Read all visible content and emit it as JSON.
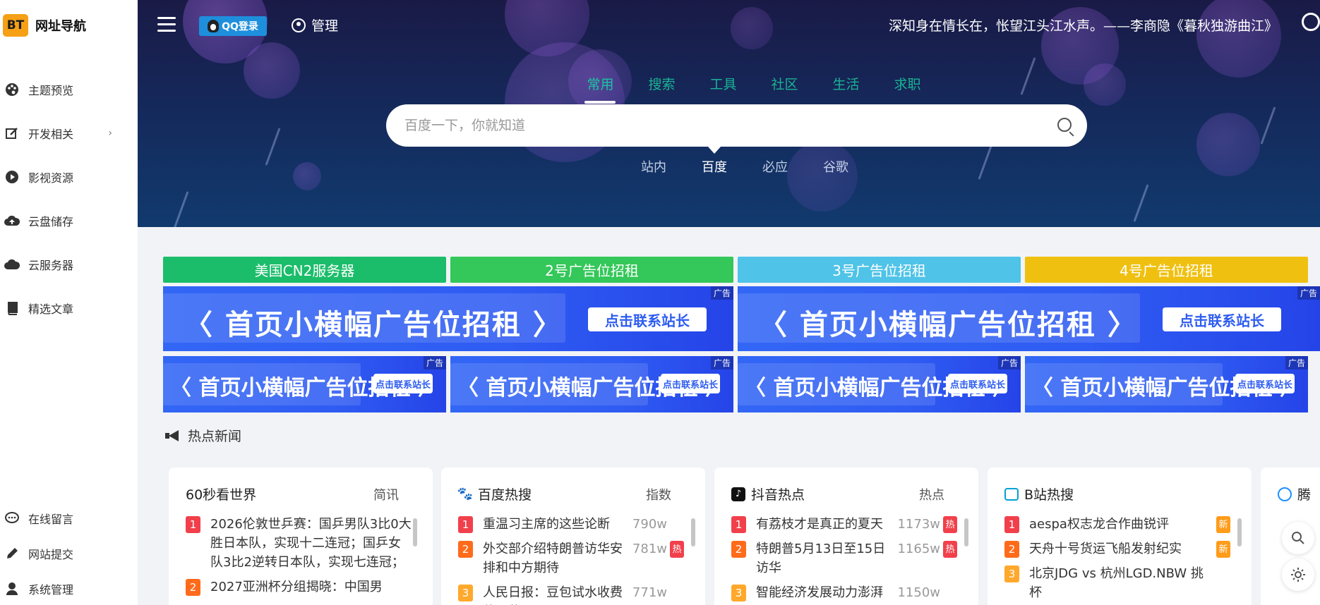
{
  "sidebar": {
    "logo_badge": "BT",
    "logo_text": "网址导航",
    "items": [
      {
        "label": "主题预览"
      },
      {
        "label": "开发相关"
      },
      {
        "label": "影视资源"
      },
      {
        "label": "云盘储存"
      },
      {
        "label": "云服务器"
      },
      {
        "label": "精选文章"
      }
    ],
    "bottom_items": [
      {
        "label": "在线留言"
      },
      {
        "label": "网站提交"
      },
      {
        "label": "系统管理"
      }
    ]
  },
  "header": {
    "qq_login": "QQ登录",
    "admin": "管理",
    "quote": "深知身在情长在，怅望江头江水声。——李商隐《暮秋独游曲江》"
  },
  "search": {
    "tabs": [
      "常用",
      "搜索",
      "工具",
      "社区",
      "生活",
      "求职"
    ],
    "active_tab": "常用",
    "placeholder": "百度一下，你就知道",
    "engines": [
      "站内",
      "百度",
      "必应",
      "谷歌"
    ],
    "active_engine": "百度"
  },
  "ads": {
    "labels": [
      {
        "text": "美国CN2服务器",
        "color": "#1bbd6a"
      },
      {
        "text": "2号广告位招租",
        "color": "#34c759"
      },
      {
        "text": "3号广告位招租",
        "color": "#4fc3e8"
      },
      {
        "text": "4号广告位招租",
        "color": "#f0c010"
      }
    ],
    "banner_text": "〈 首页小横幅广告位招租 〉",
    "banner_button": "点击联系站长",
    "ad_tag": "广告"
  },
  "hot": {
    "title": "热点新闻",
    "cards": [
      {
        "title": "60秒看世界",
        "meta": "简讯",
        "rows": [
          {
            "rank": "1",
            "text": "2026伦敦世乒赛：国乒男队3比0大胜日本队，实现十二连冠；国乒女队3比2逆转日本队，实现七连冠；"
          },
          {
            "rank": "2",
            "text": "2027亚洲杯分组揭晓：中国男"
          }
        ]
      },
      {
        "title": "百度热搜",
        "meta": "指数",
        "rows": [
          {
            "rank": "1",
            "text": "重温习主席的这些论断",
            "value": "790w",
            "badge": ""
          },
          {
            "rank": "2",
            "text": "外交部介绍特朗普访华安排和中方期待",
            "value": "781w",
            "badge": "热"
          },
          {
            "rank": "3",
            "text": "人民日报：豆包试水收费使不使",
            "value": "771w",
            "badge": ""
          }
        ]
      },
      {
        "title": "抖音热点",
        "meta": "热点",
        "rows": [
          {
            "rank": "1",
            "text": "有荔枝才是真正的夏天",
            "value": "1173w",
            "badge": "热"
          },
          {
            "rank": "2",
            "text": "特朗普5月13日至15日访华",
            "value": "1165w",
            "badge": "热"
          },
          {
            "rank": "3",
            "text": "智能经济发展动力澎湃",
            "value": "1150w",
            "badge": ""
          }
        ]
      },
      {
        "title": "B站热搜",
        "meta": "",
        "rows": [
          {
            "rank": "1",
            "text": "aespa权志龙合作曲锐评",
            "value": "",
            "badge": "新"
          },
          {
            "rank": "2",
            "text": "天舟十号货运飞船发射纪实",
            "value": "",
            "badge": "新"
          },
          {
            "rank": "3",
            "text": "北京JDG vs 杭州LGD.NBW 挑杯",
            "value": "",
            "badge": ""
          }
        ]
      },
      {
        "title": "腾",
        "meta": "",
        "rows": []
      }
    ]
  }
}
